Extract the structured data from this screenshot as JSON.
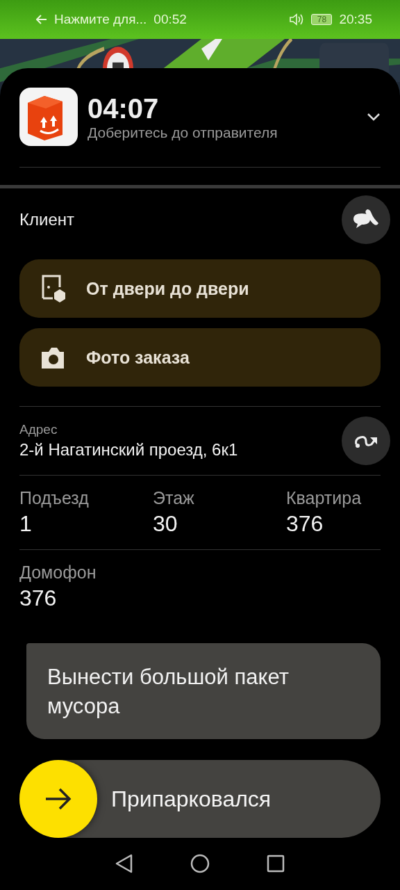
{
  "status_bar": {
    "notification": "Нажмите для...",
    "timer": "00:52",
    "battery": "78",
    "time": "20:35"
  },
  "header": {
    "time": "04:07",
    "subtitle": "Доберитесь до отправителя"
  },
  "client": {
    "label": "Клиент"
  },
  "actions": [
    {
      "kind": "door",
      "label": "От двери до двери"
    },
    {
      "label": "Фото заказа"
    }
  ],
  "address": {
    "label": "Адрес",
    "value": "2-й Нагатинский проезд, 6к1"
  },
  "details": [
    {
      "label": "Подъезд",
      "value": "1"
    },
    {
      "label": "Этаж",
      "value": "30"
    },
    {
      "label": "Квартира",
      "value": "376"
    }
  ],
  "intercom": {
    "label": "Домофон",
    "value": "376"
  },
  "comment": "Вынести большой пакет мусора",
  "slider": {
    "label": "Припарковался",
    "level": 0
  }
}
